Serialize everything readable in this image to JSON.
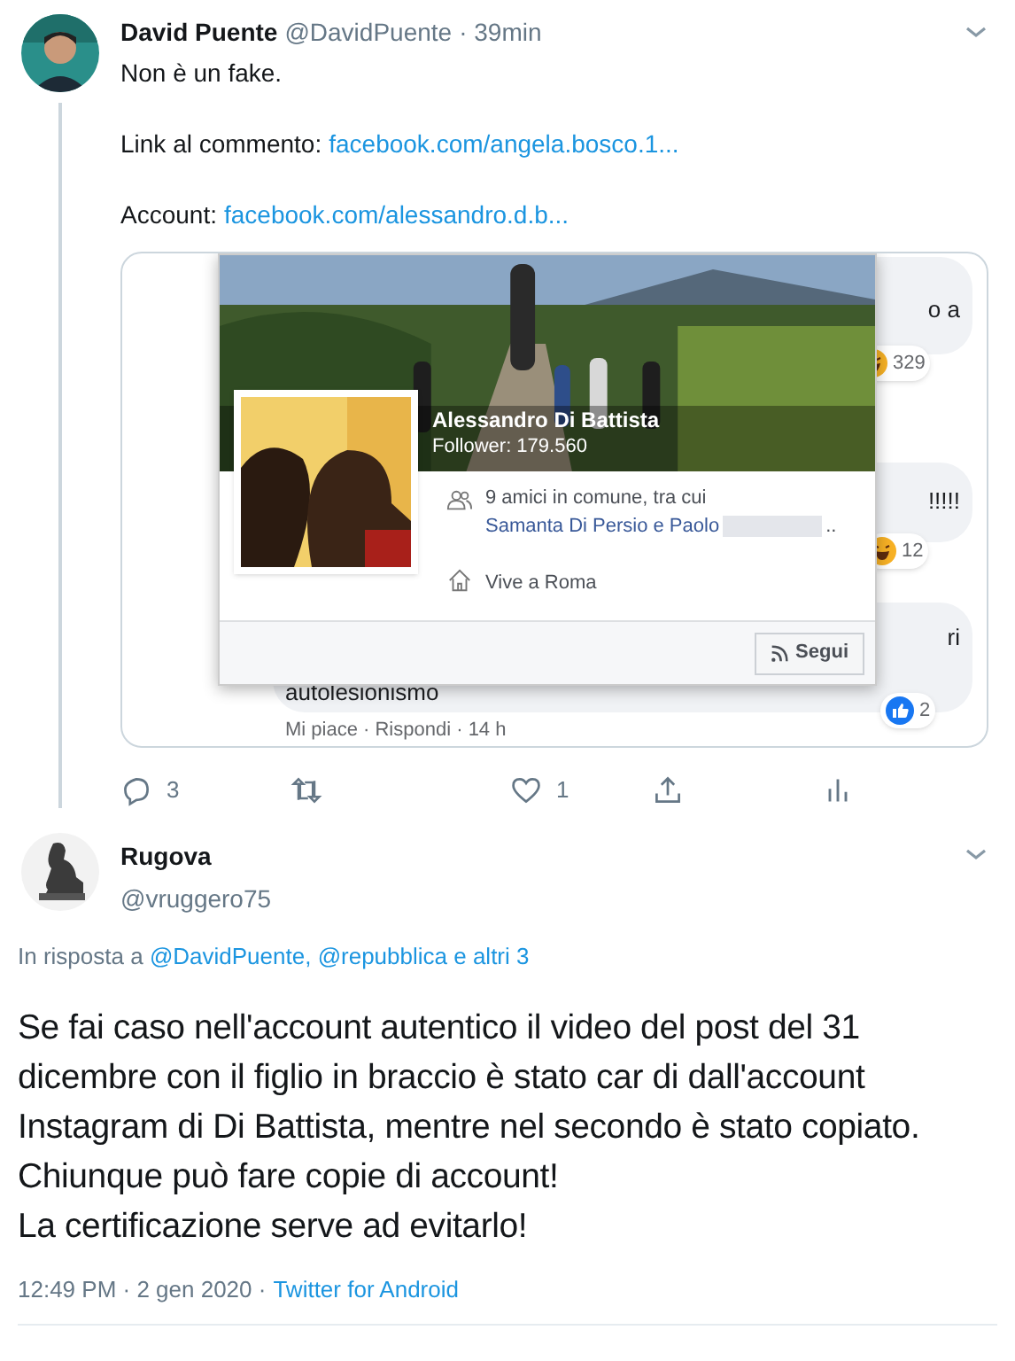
{
  "thread_tweet": {
    "author": {
      "name": "David Puente",
      "handle": "@DavidPuente",
      "time": "· 39min"
    },
    "text": "Non è un fake.",
    "links": [
      {
        "label": "Link al commento:",
        "url": "facebook.com/angela.bosco.1..."
      },
      {
        "label": "Account:",
        "url": "facebook.com/alessandro.d.b..."
      }
    ],
    "embedded_screenshot": {
      "comments": [
        {
          "fragment": "o a",
          "kind": "haha",
          "count": "329"
        },
        {
          "fragment": "!!!!!",
          "kind": "haha",
          "count": "12"
        },
        {
          "fragment": "ri",
          "lower_text": "autolesionismo",
          "kind": "like",
          "count": "2"
        }
      ],
      "comment_meta": "Mi piace · Rispondi · 14 h",
      "hover_card": {
        "name": "Alessandro Di Battista",
        "followers": "Follower: 179.560",
        "mutual_prefix": "9 amici in comune, tra cui",
        "mutual_link": "Samanta Di Persio e Paolo",
        "mutual_suffix": "..",
        "location": "Vive a Roma",
        "button": "Segui"
      }
    },
    "actions": [
      {
        "kind": "reply",
        "count": "3"
      },
      {
        "kind": "retweet"
      },
      {
        "kind": "like",
        "count": "1"
      },
      {
        "kind": "share"
      },
      {
        "kind": "analytics"
      }
    ]
  },
  "reply_tweet": {
    "author": {
      "name": "Rugova",
      "handle": "@vruggero75"
    },
    "reply_to": {
      "prefix": "In risposta a",
      "mentions": [
        "@DavidPuente,",
        "@repubblica e altri 3"
      ]
    },
    "paragraphs": [
      "Se fai caso nell'account autentico il video del post del 31 dicembre con il figlio in braccio è stato car di dall'account Instagram di Di Battista, mentre nel secondo è stato copiato.",
      "Chiunque può fare copie di account!",
      "La certificazione serve ad evitarlo!"
    ],
    "timestamp": "12:49 PM · 2 gen 2020 ·",
    "source": "Twitter for Android"
  }
}
